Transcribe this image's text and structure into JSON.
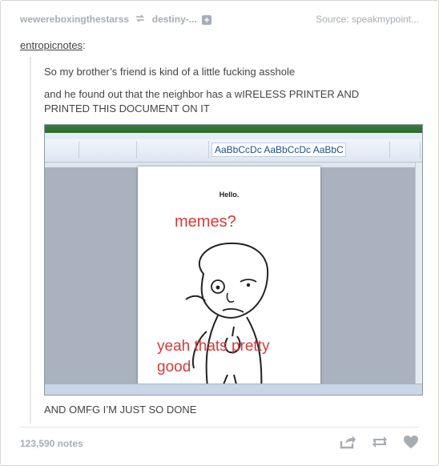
{
  "post": {
    "reblogged_from": "wewereboxingthestarss",
    "reblog_source": "destiny-...",
    "source_label": "Source: speakmypoint...",
    "author": "entropicnotes",
    "author_suffix": ":"
  },
  "quote": {
    "line1": "So my brother’s friend is kind of a little fucking asshole",
    "line2a": "and he found out that the neighbor has a wIRELESS PRINTER AND",
    "line2b": "PRINTED THIS DOCUMENT ON IT",
    "closing": "AND OMFG I’M JUST SO DONE"
  },
  "document": {
    "hello": "Hello.",
    "memes": "memes?",
    "yeah": "yeah thats pretty",
    "good": "good",
    "style_label": "AaBbCcDc AaBbCcDc AaBbC AaBbCc AaBbC AaB"
  },
  "footer": {
    "notes": "123,590 notes"
  },
  "icons": {
    "reblog": "reblog-icon",
    "plus": "plus-icon",
    "share": "share-icon",
    "like": "heart-icon"
  },
  "colors": {
    "meta_text": "#a7adb4",
    "body_text": "#444444",
    "handwriting_red": "#d63a3a",
    "ribbon_green": "#3b7d3b"
  }
}
